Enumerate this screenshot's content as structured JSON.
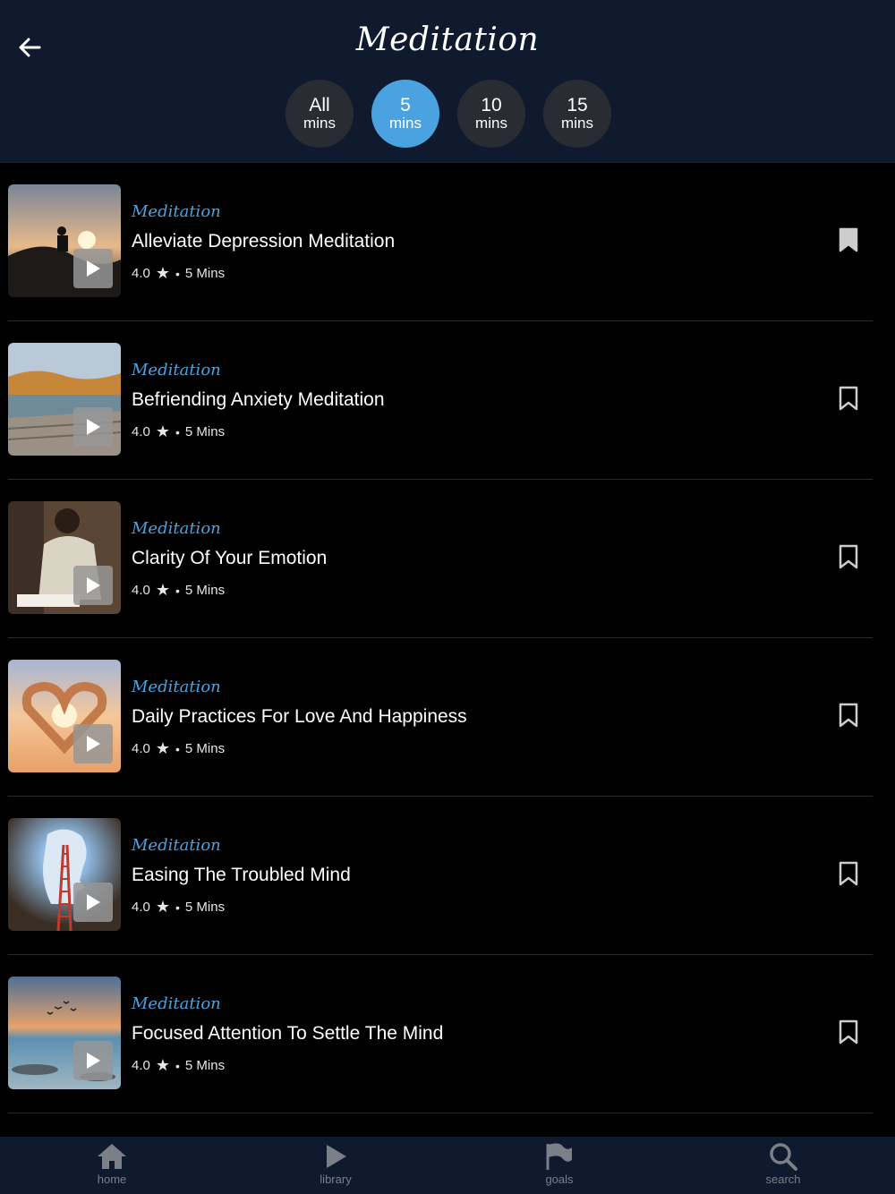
{
  "header": {
    "title": "Meditation",
    "filters": [
      {
        "num": "All",
        "unit": "mins",
        "active": false
      },
      {
        "num": "5",
        "unit": "mins",
        "active": true
      },
      {
        "num": "10",
        "unit": "mins",
        "active": false
      },
      {
        "num": "15",
        "unit": "mins",
        "active": false
      }
    ]
  },
  "items": [
    {
      "category": "Meditation",
      "title": "Alleviate Depression Meditation",
      "rating": "4.0",
      "duration": "5 Mins",
      "bookmarked": true
    },
    {
      "category": "Meditation",
      "title": "Befriending Anxiety Meditation",
      "rating": "4.0",
      "duration": "5 Mins",
      "bookmarked": false
    },
    {
      "category": "Meditation",
      "title": "Clarity Of Your Emotion",
      "rating": "4.0",
      "duration": "5 Mins",
      "bookmarked": false
    },
    {
      "category": "Meditation",
      "title": "Daily Practices For Love And Happiness",
      "rating": "4.0",
      "duration": "5 Mins",
      "bookmarked": false
    },
    {
      "category": "Meditation",
      "title": "Easing The Troubled Mind",
      "rating": "4.0",
      "duration": "5 Mins",
      "bookmarked": false
    },
    {
      "category": "Meditation",
      "title": "Focused Attention To Settle The Mind",
      "rating": "4.0",
      "duration": "5 Mins",
      "bookmarked": false
    }
  ],
  "meta_separator": "•",
  "star_glyph": "★",
  "bottom_nav": [
    {
      "label": "home",
      "icon": "home-icon"
    },
    {
      "label": "library",
      "icon": "play-icon"
    },
    {
      "label": "goals",
      "icon": "flag-icon"
    },
    {
      "label": "search",
      "icon": "search-icon"
    }
  ],
  "colors": {
    "accent": "#4aa3e0",
    "header_bg": "#0f1a2e",
    "pill_bg": "#2a2c33",
    "nav_inactive": "#7a7f88"
  }
}
